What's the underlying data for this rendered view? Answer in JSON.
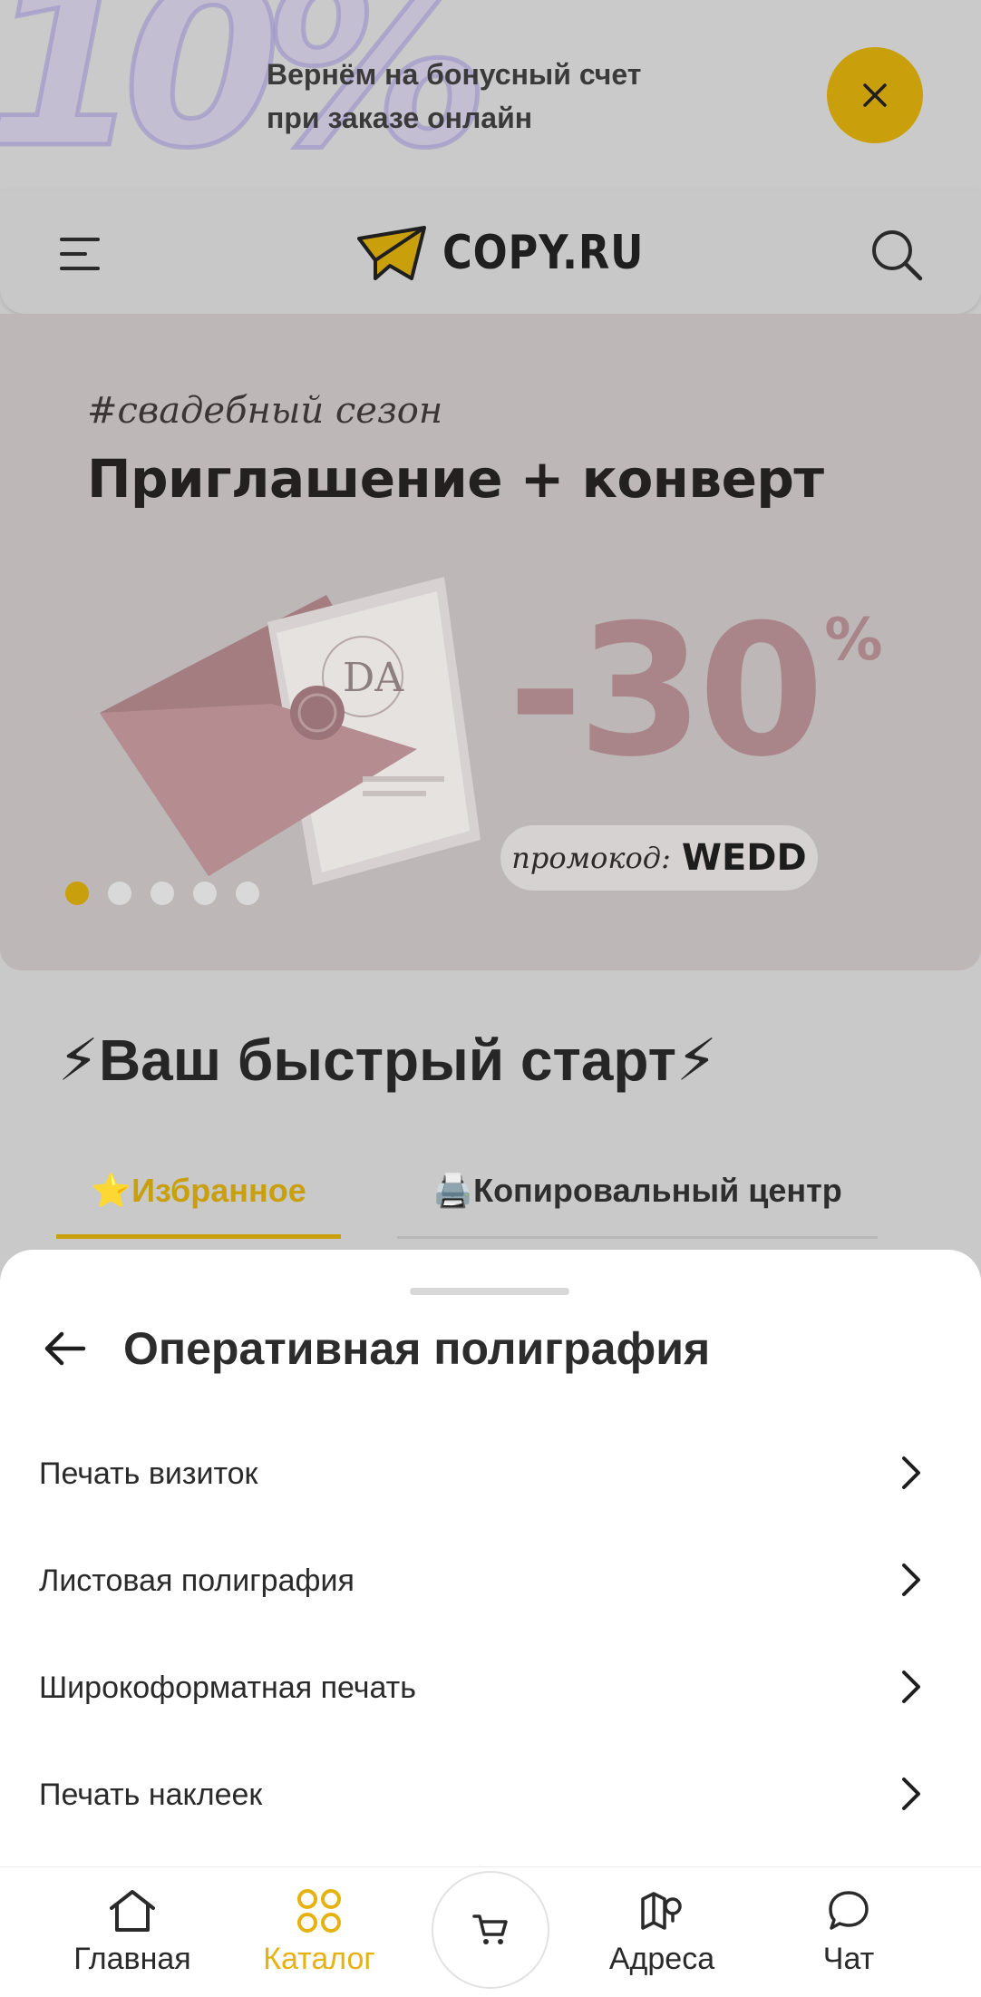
{
  "promo_strip": {
    "big_text": "10%",
    "text_line1": "Вернём на бонусный счет",
    "text_line2": "при заказе онлайн",
    "close_icon": "close-icon"
  },
  "header": {
    "menu_icon": "menu-icon",
    "logo_text": "COPY.RU",
    "search_icon": "search-icon"
  },
  "banner": {
    "tag": "#свадебный сезон",
    "title": "Приглашение + конверт",
    "discount": "-30",
    "discount_unit": "%",
    "promo_label": "промокод:",
    "promo_code": "WEDD",
    "slides_total": 5,
    "active_slide": 1
  },
  "quick_start": {
    "title": "⚡Ваш быстрый старт⚡",
    "tabs": [
      {
        "label": "⭐Избранное",
        "active": true
      },
      {
        "label": "🖨️Копировальный центр",
        "active": false
      }
    ]
  },
  "sheet": {
    "title": "Оперативная полиграфия",
    "items": [
      {
        "label": "Печать визиток"
      },
      {
        "label": "Листовая полиграфия"
      },
      {
        "label": "Широкоформатная печать"
      },
      {
        "label": "Печать наклеек"
      }
    ]
  },
  "nav": {
    "items": [
      {
        "label": "Главная",
        "icon": "home-icon"
      },
      {
        "label": "Каталог",
        "icon": "catalog-icon",
        "active": true
      },
      {
        "label": "Адреса",
        "icon": "map-icon"
      },
      {
        "label": "Чат",
        "icon": "chat-icon"
      }
    ],
    "cart_icon": "cart-icon"
  },
  "colors": {
    "accent": "#e5b20f",
    "accent_dimmed": "#c9a00c",
    "overlay_bg": "#c9c9c9",
    "banner_pink": "#a98589"
  }
}
